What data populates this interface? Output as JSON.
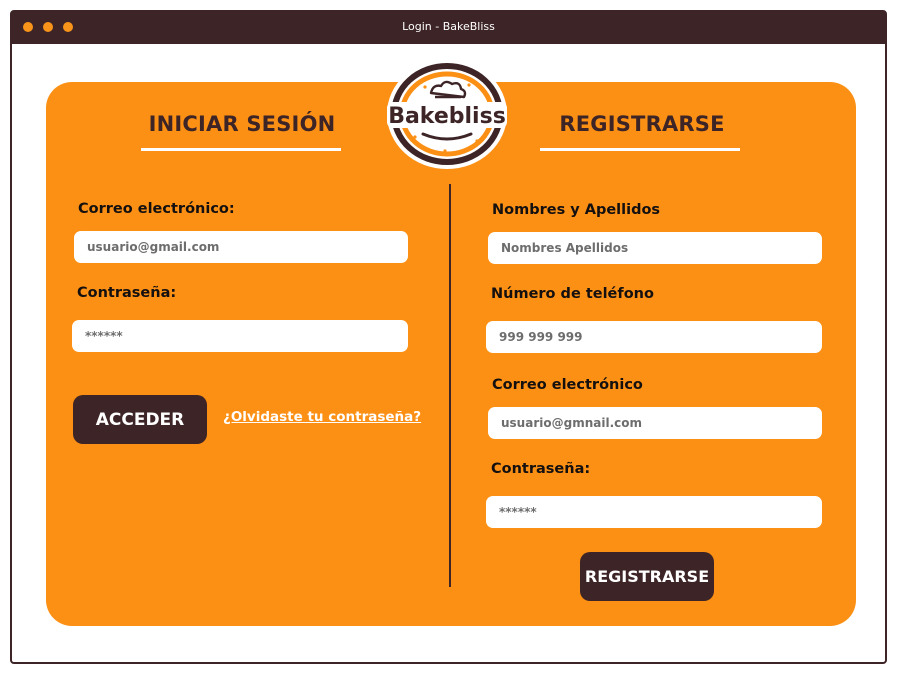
{
  "window": {
    "title": "Login - BakeBliss",
    "dot_color": "#f9941a",
    "bar_color": "#3d2426"
  },
  "brand": {
    "logo_text": "Bakebliss",
    "accent": "#fb9015",
    "dark": "#3d2426"
  },
  "login": {
    "heading": "INICIAR SESIÓN",
    "email_label": "Correo electrónico:",
    "email_placeholder": "usuario@gmail.com",
    "password_label": "Contraseña:",
    "password_placeholder": "******",
    "submit_label": "ACCEDER",
    "forgot_label": "¿Olvidaste tu contraseña?"
  },
  "register": {
    "heading": "REGISTRARSE",
    "name_label": "Nombres y Apellidos",
    "name_placeholder": "Nombres Apellidos",
    "phone_label": "Número de teléfono",
    "phone_placeholder": "999 999 999",
    "email_label": "Correo electrónico",
    "email_placeholder": "usuario@gmnail.com",
    "password_label": "Contraseña:",
    "password_placeholder": "******",
    "submit_label": "REGISTRARSE"
  }
}
